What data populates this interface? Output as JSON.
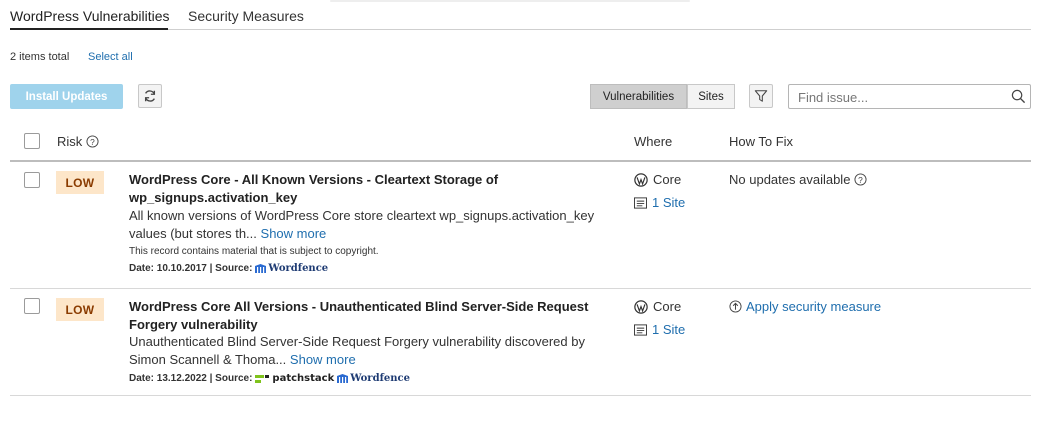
{
  "tabs": [
    {
      "label": "WordPress Vulnerabilities",
      "active": true
    },
    {
      "label": "Security Measures",
      "active": false
    }
  ],
  "toolbar": {
    "items_total": "2 items total",
    "select_all": "Select all",
    "install_updates": "Install Updates",
    "view_vulnerabilities": "Vulnerabilities",
    "view_sites": "Sites",
    "search_placeholder": "Find issue..."
  },
  "columns": {
    "risk": "Risk",
    "where": "Where",
    "how_to_fix": "How To Fix"
  },
  "rows": [
    {
      "risk": "LOW",
      "title": "WordPress Core - All Known Versions - Cleartext Storage of wp_signups.activation_key",
      "description": "All known versions of WordPress Core store cleartext wp_signups.activation_key values (but stores th...",
      "show_more": "Show more",
      "copyright_note": "This record contains material that is subject to copyright.",
      "date_label": "Date: 10.10.2017 | Source:",
      "sources": [
        "Wordfence"
      ],
      "where_label": "Core",
      "sites_link": "1 Site",
      "fix_text": "No updates available"
    },
    {
      "risk": "LOW",
      "title": "WordPress Core All Versions - Unauthenticated Blind Server-Side Request Forgery vulnerability",
      "description": "Unauthenticated Blind Server-Side Request Forgery vulnerability discovered by Simon Scannell & Thoma...",
      "show_more": "Show more",
      "date_label": "Date: 13.12.2022 | Source:",
      "sources": [
        "patchstack",
        "Wordfence"
      ],
      "where_label": "Core",
      "sites_link": "1 Site",
      "fix_text": "Apply security measure"
    }
  ],
  "colors": {
    "accent_link": "#1f6eae",
    "install_button": "#9fd3ec",
    "low_badge_bg": "#fde6c9",
    "low_badge_text": "#8a3b00"
  }
}
